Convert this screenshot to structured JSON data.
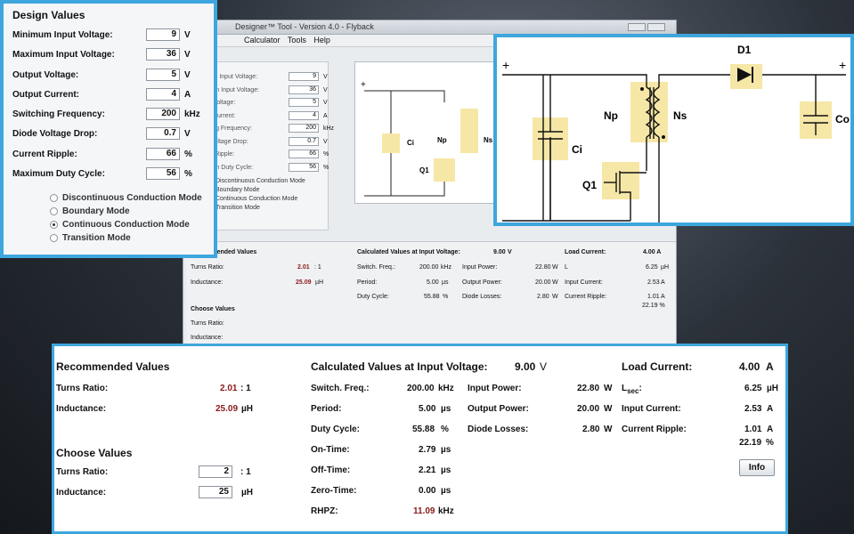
{
  "window": {
    "title": "Designer™ Tool - Version 4.0 - Flyback",
    "menu": [
      "Calculator",
      "Tools",
      "Help"
    ]
  },
  "design": {
    "heading": "Design Values",
    "fields": [
      {
        "label": "Minimum Input Voltage:",
        "value": "9",
        "unit": "V"
      },
      {
        "label": "Maximum Input Voltage:",
        "value": "36",
        "unit": "V"
      },
      {
        "label": "Output Voltage:",
        "value": "5",
        "unit": "V"
      },
      {
        "label": "Output Current:",
        "value": "4",
        "unit": "A"
      },
      {
        "label": "Switching Frequency:",
        "value": "200",
        "unit": "kHz"
      },
      {
        "label": "Diode Voltage Drop:",
        "value": "0.7",
        "unit": "V"
      },
      {
        "label": "Current Ripple:",
        "value": "66",
        "unit": "%"
      },
      {
        "label": "Maximum Duty Cycle:",
        "value": "56",
        "unit": "%"
      }
    ],
    "modes": [
      {
        "label": "Discontinuous Conduction Mode",
        "selected": false
      },
      {
        "label": "Boundary Mode",
        "selected": false
      },
      {
        "label": "Continuous Conduction Mode",
        "selected": true
      },
      {
        "label": "Transition Mode",
        "selected": false
      }
    ]
  },
  "schematic": {
    "labels": {
      "ci": "Ci",
      "np": "Np",
      "ns": "Ns",
      "q1": "Q1",
      "d1": "D1",
      "co": "Co",
      "plus": "+"
    },
    "highlight": "#f6e7a6"
  },
  "recommended": {
    "heading": "Recommended Values",
    "turns_label": "Turns Ratio:",
    "turns_value": "2.01",
    "turns_unit": ": 1",
    "inductance_label": "Inductance:",
    "inductance_value": "25.09",
    "inductance_unit": "µH"
  },
  "choose": {
    "heading": "Choose Values",
    "turns_label": "Turns Ratio:",
    "turns_value": "2",
    "turns_unit": ": 1",
    "inductance_label": "Inductance:",
    "inductance_value": "25",
    "inductance_unit": "µH"
  },
  "calculated": {
    "heading": "Calculated Values at Input Voltage:",
    "input_voltage": "9.00",
    "input_voltage_unit": "V",
    "col1": [
      {
        "label": "Switch. Freq.:",
        "value": "200.00",
        "unit": "kHz",
        "highlight": false
      },
      {
        "label": "Period:",
        "value": "5.00",
        "unit": "µs",
        "highlight": false
      },
      {
        "label": "Duty Cycle:",
        "value": "55.88",
        "unit": "%",
        "highlight": false
      },
      {
        "label": "On-Time:",
        "value": "2.79",
        "unit": "µs",
        "highlight": false
      },
      {
        "label": "Off-Time:",
        "value": "2.21",
        "unit": "µs",
        "highlight": false
      },
      {
        "label": "Zero-Time:",
        "value": "0.00",
        "unit": "µs",
        "highlight": false
      },
      {
        "label": "RHPZ:",
        "value": "11.09",
        "unit": "kHz",
        "highlight": true
      }
    ],
    "col2": [
      {
        "label": "Input Power:",
        "value": "22.80",
        "unit": "W"
      },
      {
        "label": "Output Power:",
        "value": "20.00",
        "unit": "W"
      },
      {
        "label": "Diode Losses:",
        "value": "2.80",
        "unit": "W"
      }
    ]
  },
  "load": {
    "heading": "Load Current:",
    "value": "4.00",
    "unit": "A",
    "lsec_label": "L",
    "lsec_sub": "sec",
    "lsec_colon": ":",
    "lsec_value": "6.25",
    "lsec_unit": "µH",
    "input_current_label": "Input Current:",
    "input_current_value": "2.53",
    "input_current_unit": "A",
    "ripple_label": "Current Ripple:",
    "ripple_value1": "1.01",
    "ripple_unit1": "A",
    "ripple_value2": "22.19",
    "ripple_unit2": "%",
    "info_button": "Info"
  },
  "bg_partial": {
    "load_value": "4.00 A",
    "choose_heading": "Choose Values",
    "turns_label": "Turns Ratio:",
    "inductance_label": "Inductance:",
    "info": "Info",
    "ripple_pct": "22.19 %"
  },
  "colors": {
    "accent": "#3ea6dd",
    "highlight_red": "#8b1a1a",
    "component_fill": "#f6e7a6"
  }
}
